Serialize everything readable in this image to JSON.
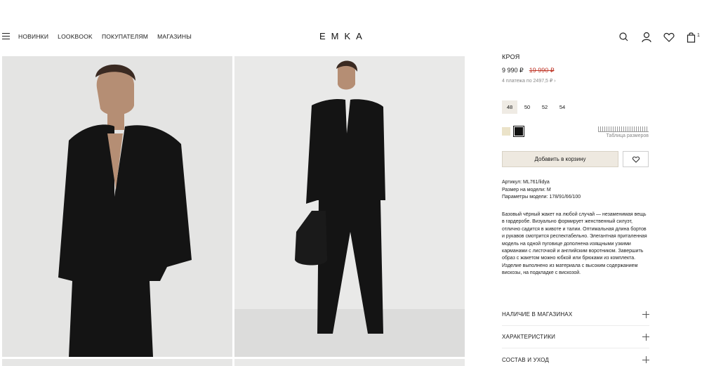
{
  "header": {
    "nav": [
      "НОВИНКИ",
      "LOOKBOOK",
      "ПОКУПАТЕЛЯМ",
      "МАГАЗИНЫ"
    ],
    "logo": "EMKA",
    "cart_count": "1",
    "icons": [
      "menu-icon",
      "search-icon",
      "user-icon",
      "heart-icon",
      "bag-icon"
    ]
  },
  "product": {
    "title_tail": "КРОЯ",
    "price": "9 990 ₽",
    "old_price": "19 990 ₽",
    "installments": "4 платежа по 2497,5 ₽  ›",
    "sizes": [
      "48",
      "50",
      "52",
      "54"
    ],
    "selected_size": "48",
    "colors": [
      "#ebe3c9",
      "#111111"
    ],
    "size_chart_label": "Таблица размеров",
    "add_to_cart": "Добавить в корзину",
    "specs": {
      "article": "Артикул: ML761/lidya",
      "model_size": "Размер на модели: M",
      "model_params": "Параметры модели: 178/91/66/100"
    },
    "description": "Базовый чёрный жакет на любой случай — незаменимая вещь в гардеробе. Визуально формирует женственный силуэт, отлично садится в животе и талии. Оптимальная длина бортов и рукавов смотрится респектабельно. Элегантная приталенная модель на одной пуговице дополнена изящными узкими карманами с листочкой и английским воротником. Завершить образ с жакетом можно юбкой или брюками из комплекта. Изделие выполнено из материала с высоким содержанием вискозы, на подкладке с вискозой.",
    "accordions": [
      "НАЛИЧИЕ В МАГАЗИНАХ",
      "ХАРАКТЕРИСТИКИ",
      "СОСТАВ И УХОД"
    ]
  }
}
